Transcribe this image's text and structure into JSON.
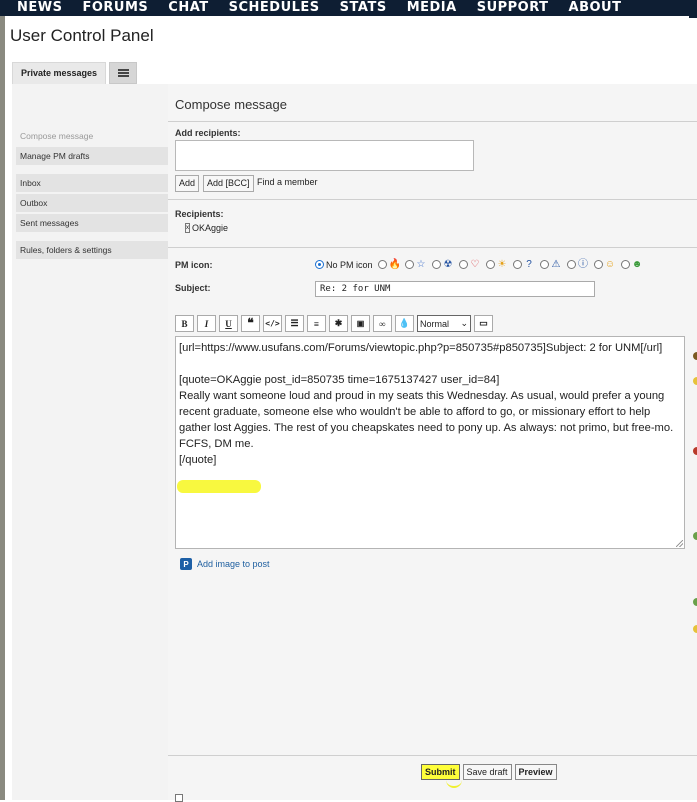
{
  "topnav": {
    "items": [
      "NEWS",
      "FORUMS",
      "CHAT",
      "SCHEDULES",
      "STATS",
      "MEDIA",
      "SUPPORT",
      "ABOUT"
    ]
  },
  "page_title": "User Control Panel",
  "tabs": {
    "private_messages": "Private messages"
  },
  "sidenav": {
    "group1": [
      "Compose message",
      "Manage PM drafts"
    ],
    "group2": [
      "Inbox",
      "Outbox",
      "Sent messages"
    ],
    "group3": [
      "Rules, folders & settings"
    ]
  },
  "compose": {
    "title": "Compose message",
    "add_recipients_label": "Add recipients:",
    "add_button": "Add",
    "add_bcc_button": "Add [BCC]",
    "find_member": "Find a member",
    "recipients_label": "Recipients:",
    "recipient": "OKAggie",
    "pm_icon_label": "PM icon:",
    "no_pm_icon": "No PM icon",
    "subject_label": "Subject:",
    "subject_value": "Re: 2 for UNM",
    "font_size_select": "Normal",
    "toolbar_icons": [
      "bold-icon",
      "italic-icon",
      "underline-icon",
      "quote-icon",
      "code-icon",
      "list-icon",
      "ordered-list-icon",
      "list-item-icon",
      "image-icon",
      "link-icon",
      "color-icon"
    ],
    "message_lines": [
      "[url=https://www.usufans.com/Forums/viewtopic.php?p=850735#p850735]Subject: 2 for UNM[/url]",
      "",
      "[quote=OKAggie post_id=850735 time=1675137427 user_id=84]",
      "Really want someone loud and proud in my seats this Wednesday. As usual, would prefer a young recent graduate, someone else who wouldn't be able to afford to go, or missionary effort to help gather lost Aggies. The rest of you cheapskates need to pony up. As always: not primo, but free-mo. FCFS, DM me.",
      "[/quote]"
    ],
    "add_image": "Add image to post"
  },
  "footer": {
    "submit": "Submit",
    "save_draft": "Save draft",
    "preview": "Preview"
  },
  "colors": {
    "nav_bg": "#0e1e33",
    "highlight": "#ffff3a",
    "link": "#2060a0"
  }
}
